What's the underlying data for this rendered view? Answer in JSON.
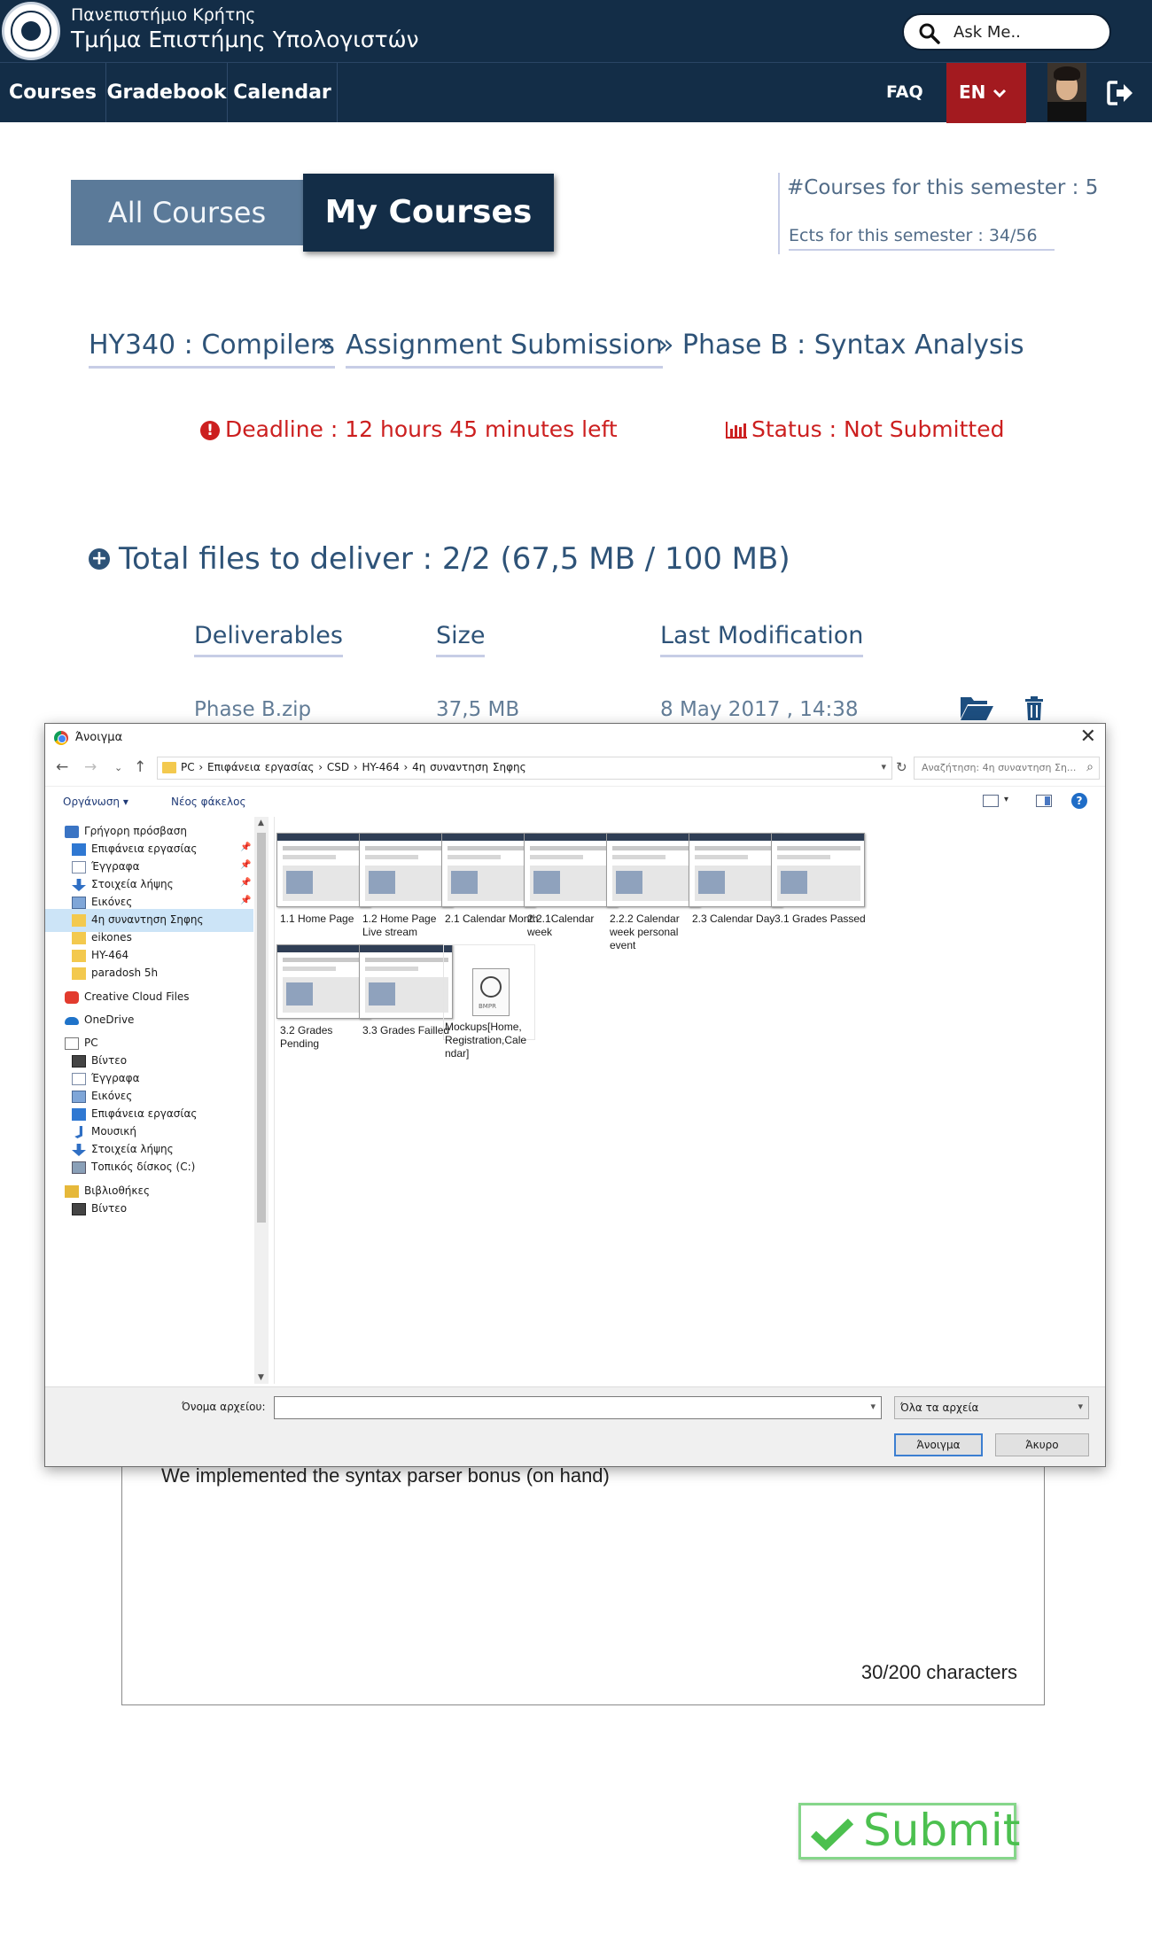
{
  "header": {
    "university": "Πανεπιστήμιο Κρήτης",
    "department": "Τμήμα Επιστήμης Υπολογιστών",
    "ask_placeholder": "Ask Me.."
  },
  "nav": {
    "courses": "Courses",
    "gradebook": "Gradebook",
    "calendar": "Calendar",
    "faq": "FAQ",
    "language": "EN",
    "lang_bg": "#a31a1f",
    "bar_bg": "#132d47"
  },
  "tabs": {
    "all_courses": "All Courses",
    "my_courses": "My Courses"
  },
  "stats": {
    "courses_semester": "#Courses for this semester : 5",
    "ects_semester": "Ects for this semester : 34/56"
  },
  "breadcrumb": {
    "course": "HY340 : Compilers",
    "sep": "»",
    "assignment": "Assignment Submission",
    "phase": "» Phase B : Syntax Analysis"
  },
  "deadline": {
    "icon": "!",
    "text": "Deadline : 12 hours 45 minutes left",
    "status": "Status : Not Submitted",
    "color": "#cc1f1f"
  },
  "files": {
    "plus_icon": "+",
    "total": "Total files to deliver : 2/2 (67,5 MB / 100 MB)",
    "columns": {
      "deliverables": "Deliverables",
      "size": "Size",
      "last_modification": "Last Modification"
    },
    "rows": [
      {
        "name": "Phase B.zip",
        "size": "37,5 MB",
        "modified": "8 May 2017 , 14:38"
      }
    ]
  },
  "comments": {
    "text": "We implemented the syntax parser bonus (on hand)",
    "char_count": "30/200 characters"
  },
  "submit": {
    "label": "Submit",
    "color": "#4cc04f"
  },
  "dialog": {
    "title": "Άνοιγμα",
    "close": "✕",
    "path": "PC  ›  Επιφάνεια εργασίας  ›  CSD  ›  HY-464  ›  4η συναντηση Σηφης",
    "search_placeholder": "Αναζήτηση: 4η συναντηση Ση...",
    "organize": "Οργάνωση ▾",
    "new_folder": "Νέος φάκελος",
    "help": "?",
    "nav_items": [
      {
        "label": "Γρήγορη πρόσβαση",
        "icon": "star-icon",
        "pinned": false
      },
      {
        "label": "Επιφάνεια εργασίας",
        "icon": "desktop-icon",
        "pinned": true
      },
      {
        "label": "Έγγραφα",
        "icon": "documents-icon",
        "pinned": true
      },
      {
        "label": "Στοιχεία λήψης",
        "icon": "downloads-icon",
        "pinned": true
      },
      {
        "label": "Εικόνες",
        "icon": "pictures-icon",
        "pinned": true
      },
      {
        "label": "4η συναντηση Σηφης",
        "icon": "folder-icon",
        "pinned": false,
        "selected": true
      },
      {
        "label": "eikones",
        "icon": "folder-icon",
        "pinned": false
      },
      {
        "label": "HY-464",
        "icon": "folder-icon",
        "pinned": false
      },
      {
        "label": "paradosh 5h",
        "icon": "folder-icon",
        "pinned": false
      },
      {
        "label": "Creative Cloud Files",
        "icon": "creative-cloud-icon",
        "pinned": false
      },
      {
        "label": "OneDrive",
        "icon": "onedrive-icon",
        "pinned": false
      },
      {
        "label": "PC",
        "icon": "pc-icon",
        "pinned": false
      },
      {
        "label": "Βίντεο",
        "icon": "videos-icon",
        "pinned": false
      },
      {
        "label": "Έγγραφα",
        "icon": "documents-icon",
        "pinned": false
      },
      {
        "label": "Εικόνες",
        "icon": "pictures-icon",
        "pinned": false
      },
      {
        "label": "Επιφάνεια εργασίας",
        "icon": "desktop-icon",
        "pinned": false
      },
      {
        "label": "Μουσική",
        "icon": "music-icon",
        "pinned": false
      },
      {
        "label": "Στοιχεία λήψης",
        "icon": "downloads-icon",
        "pinned": false
      },
      {
        "label": "Τοπικός δίσκος (C:)",
        "icon": "disk-icon",
        "pinned": false
      },
      {
        "label": "Βιβλιοθήκες",
        "icon": "libraries-icon",
        "pinned": false
      },
      {
        "label": "Βίντεο",
        "icon": "videos-icon",
        "pinned": false
      }
    ],
    "files": [
      "1.1 Home Page",
      "1.2 Home Page Live stream",
      "2.1 Calendar Month",
      "2.2.1Calendar week",
      "2.2.2 Calendar week personal event",
      "2.3 Calendar Day",
      "3.1 Grades Passed",
      "3.2 Grades Pending",
      "3.3 Grades Failled",
      "Mockups[Home, Registration,Cale ndar]"
    ],
    "bmpr_tag": "BMPR",
    "filename_label": "Όνομα αρχείου:",
    "filename_value": "",
    "filetype": "Όλα τα αρχεία",
    "open_button": "Άνοιγμα",
    "cancel_button": "Άκυρο"
  }
}
